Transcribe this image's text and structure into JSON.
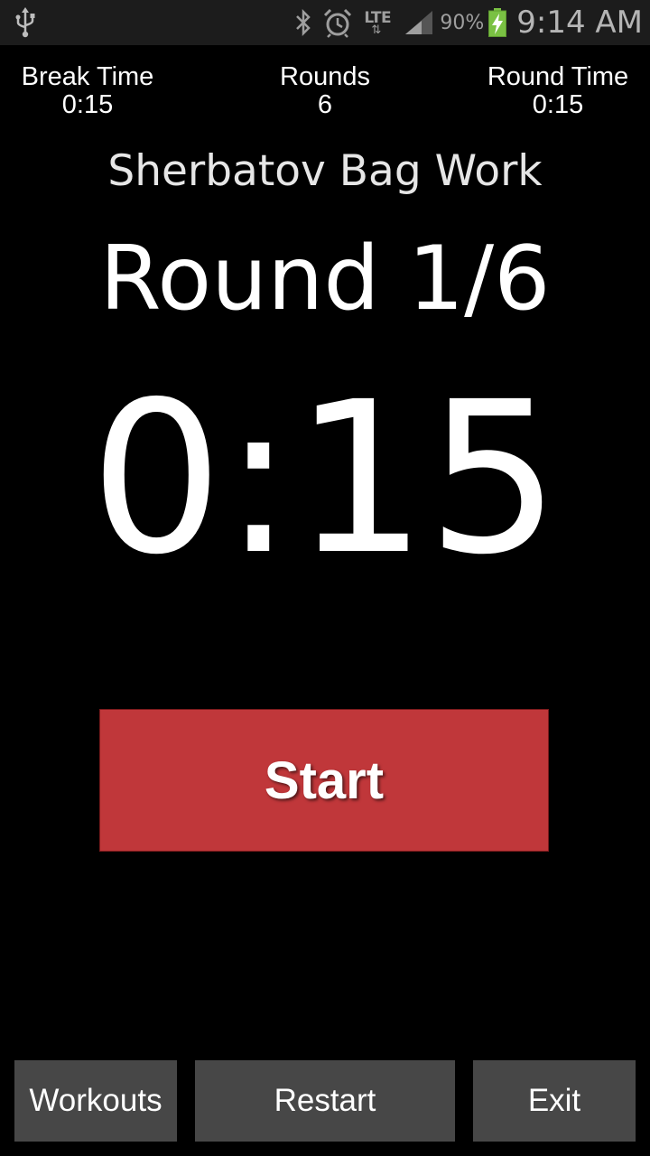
{
  "status_bar": {
    "battery_percent": "90%",
    "time": "9:14 AM",
    "network": "LTE",
    "icons": [
      "usb-icon",
      "bluetooth-icon",
      "alarm-icon",
      "lte-icon",
      "signal-icon",
      "battery-charging-icon"
    ],
    "battery_color": "#7ac143"
  },
  "info": {
    "break_time_label": "Break Time",
    "break_time_value": "0:15",
    "rounds_label": "Rounds",
    "rounds_value": "6",
    "round_time_label": "Round Time",
    "round_time_value": "0:15"
  },
  "workout_title": "Sherbatov Bag Work",
  "round_label": "Round 1/6",
  "timer": "0:15",
  "start_button_label": "Start",
  "bottom_buttons": {
    "workouts": "Workouts",
    "restart": "Restart",
    "exit": "Exit"
  },
  "colors": {
    "background": "#000000",
    "start_button": "#c0373a",
    "bottom_button": "#474747"
  }
}
